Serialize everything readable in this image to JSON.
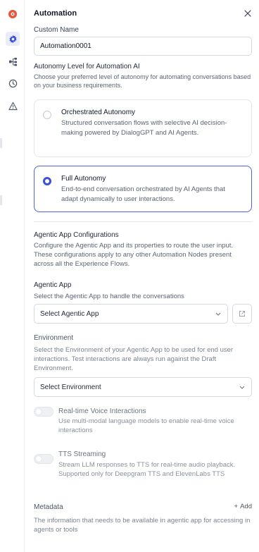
{
  "header": {
    "title": "Automation"
  },
  "custom_name": {
    "label": "Custom Name",
    "value": "Automation0001"
  },
  "autonomy": {
    "label": "Autonomy Level for Automation AI",
    "description": "Choose your preferred level of autonomy for automating conversations based on your business requirements.",
    "options": [
      {
        "title": "Orchestrated Autonomy",
        "description": "Structured conversation flows with selective AI decision-making powered by DialogGPT and AI Agents.",
        "selected": false
      },
      {
        "title": "Full Autonomy",
        "description": "End-to-end conversation orchestrated by AI Agents that adapt dynamically to user interactions.",
        "selected": true
      }
    ]
  },
  "agentic_config": {
    "title": "Agentic App Configurations",
    "description": "Configure the Agentic App and its properties to route the user input. These configurations apply to any other Automation Nodes present across all the Experience Flows."
  },
  "agentic_app": {
    "label": "Agentic App",
    "description": "Select the Agentic App to handle the conversations",
    "select_value": "Select Agentic App"
  },
  "environment": {
    "label": "Environment",
    "description": "Select the Environment of your Agentic App to be used for end user interactions. Test interactions are always run against the Draft Environment.",
    "select_value": "Select Environment"
  },
  "voice": {
    "title": "Real-time Voice Interactions",
    "description": "Use multi-modal language models to enable real-time voice interactions",
    "enabled": false
  },
  "tts": {
    "title": "TTS Streaming",
    "description": "Stream LLM responses to TTS for real-time audio playback. Supported only for Deepgram TTS and ElevenLabs TTS",
    "enabled": false
  },
  "metadata": {
    "label": "Metadata",
    "add_label": "Add",
    "description": "The information that needs to be available in agentic app for accessing in agents or tools"
  },
  "colors": {
    "accent": "#3d4fd6",
    "brand_icon": "#e8553e",
    "border": "#d5d9df"
  },
  "rail_icons": [
    "gear-badge-icon",
    "settings-icon",
    "flow-icon",
    "clock-icon",
    "alert-icon"
  ]
}
